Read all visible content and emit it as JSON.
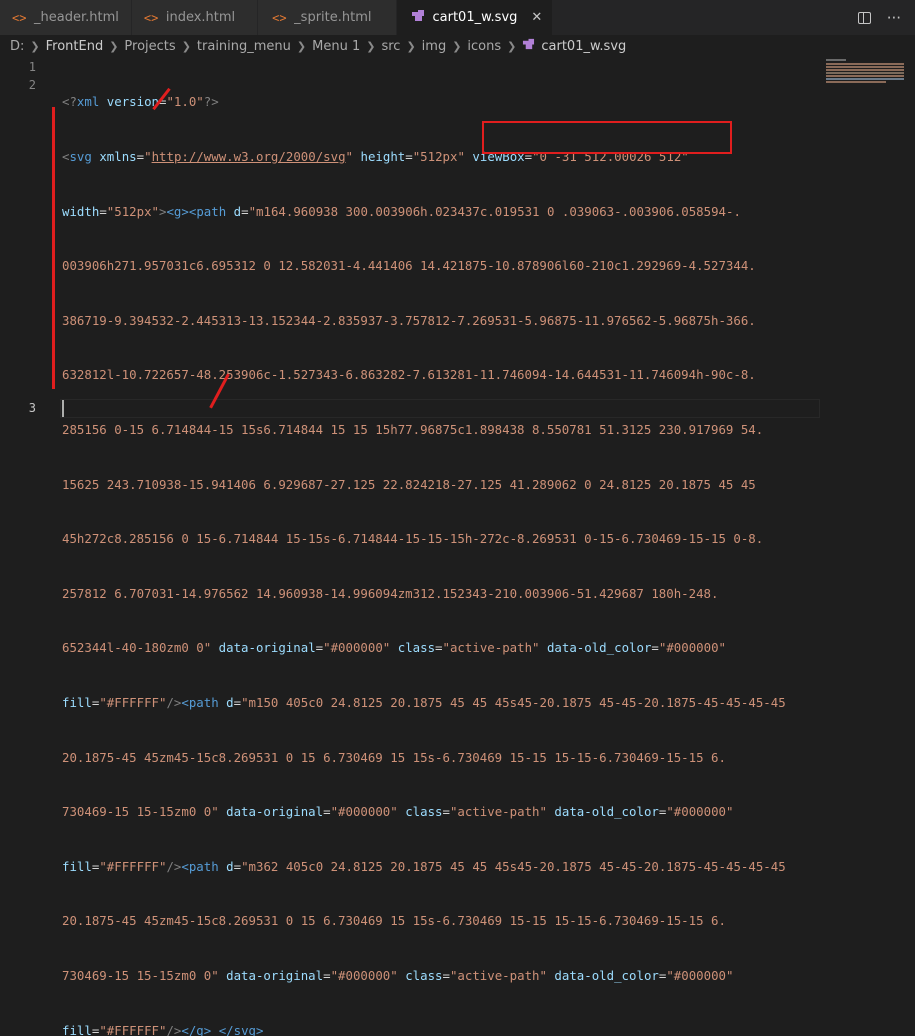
{
  "tabs": [
    {
      "icon": "<>",
      "label": "_header.html",
      "active": false
    },
    {
      "icon": "<>",
      "label": "index.html",
      "active": false
    },
    {
      "icon": "<>",
      "label": "_sprite.html",
      "active": false
    },
    {
      "icon": "svg",
      "label": "cart01_w.svg",
      "active": true
    }
  ],
  "tab_actions": {
    "more": "···"
  },
  "breadcrumbs": [
    "D:",
    "FrontEnd",
    "Projects",
    "training_menu",
    "Menu 1",
    "src",
    "img",
    "icons",
    "cart01_w.svg"
  ],
  "line_numbers": [
    "1",
    "2",
    "3"
  ],
  "code": {
    "line1": {
      "open": "<?",
      "name": "xml",
      "attr": "version",
      "eq": "=",
      "val": "\"1.0\"",
      "close": "?>"
    },
    "line2": {
      "lt": "<",
      "svg": "svg",
      "xmlns_attr": "xmlns",
      "eq": "=",
      "q": "\"",
      "xmlns_val": "http://www.w3.org/2000/svg",
      "height_attr": "height",
      "height_val": "\"512px\"",
      "viewbox_attr": "viewBox",
      "viewbox_val": "\"0 -31 512.00026 512\"",
      "width_attr": "width",
      "width_val": "\"512px\"",
      "gt": ">",
      "g_open": "<g>",
      "path_open": "<path",
      "d_attr": "d",
      "d1_a": "\"m164.960938 300.003906h.023437c.019531 0 .039063-.003906.058594-.",
      "d1_b": "003906h271.957031c6.695312 0 12.582031-4.441406 14.421875-10.878906l60-210c1.292969-4.527344.",
      "d1_c": "386719-9.394532-2.445313-13.152344-2.835937-3.757812-7.269531-5.96875-11.976562-5.96875h-366.",
      "d1_d": "632812l-10.722657-48.253906c-1.527343-6.863282-7.613281-11.746094-14.644531-11.746094h-90c-8.",
      "d1_e": "285156 0-15 6.714844-15 15s6.714844 15 15 15h77.96875c1.898438 8.550781 51.3125 230.917969 54.",
      "d1_f": "15625 243.710938-15.941406 6.929687-27.125 22.824218-27.125 41.289062 0 24.8125 20.1875 45 45",
      "d1_g": "45h272c8.285156 0 15-6.714844 15-15s-6.714844-15-15-15h-272c-8.269531 0-15-6.730469-15-15 0-8.",
      "d1_h": "257812 6.707031-14.976562 14.960938-14.996094zm312.152343-210.003906-51.429687 180h-248.",
      "d1_i": "652344l-40-180zm0 0\"",
      "data_original_attr": "data-original",
      "data_original_val": "\"#000000\"",
      "class_attr": "class",
      "class_val": "\"active-path\"",
      "data_old_attr": "data-old_color",
      "data_old_val": "\"#000000\"",
      "fill_attr": "fill",
      "fill_val": "\"#FFFFFF\"",
      "selfclose": "/>",
      "d2_a": "\"m150 405c0 24.8125 20.1875 45 45 45s45-20.1875 45-45-20.1875-45-45-45-45",
      "d2_b": "20.1875-45 45zm45-15c8.269531 0 15 6.730469 15 15s-6.730469 15-15 15-15-6.730469-15-15 6.",
      "d2_c": "730469-15 15-15zm0 0\"",
      "d3_a": "\"m362 405c0 24.8125 20.1875 45 45 45s45-20.1875 45-45-20.1875-45-45-45-45",
      "g_close": "</g>",
      "svg_close": "</svg>"
    }
  },
  "colors": {
    "annotation": "#e01e1e",
    "background": "#1e1e1e"
  }
}
